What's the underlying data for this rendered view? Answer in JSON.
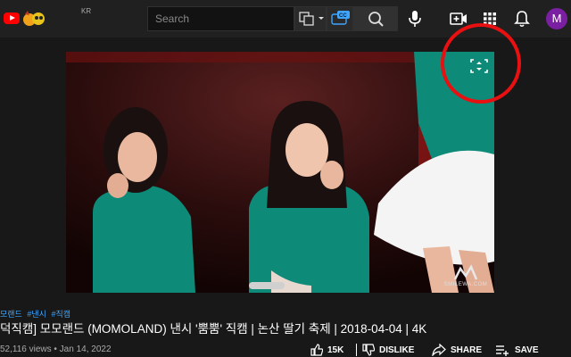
{
  "header": {
    "country_code": "KR",
    "search_placeholder": "Search",
    "avatar_letter": "M"
  },
  "video": {
    "watermark_text": "SMILEWA.COM"
  },
  "info": {
    "hashtags": [
      "모랜드",
      "#낸시",
      "#직캠"
    ],
    "title": "덕직캠] 모모랜드 (MOMOLAND) 낸시 '뿜뿜' 직캠 | 논산 딸기 축제 | 2018-04-04 | 4K",
    "meta": "52,116 views • Jan 14, 2022",
    "like_count": "15K",
    "dislike_label": "DISLIKE",
    "share_label": "SHARE",
    "save_label": "SAVE"
  },
  "colors": {
    "background": "#181818",
    "topbar": "#202020",
    "youtube_red": "#ff0000",
    "link_blue": "#3ea6ff",
    "highlight_circle": "#e81010",
    "avatar": "#7b1fa2"
  }
}
